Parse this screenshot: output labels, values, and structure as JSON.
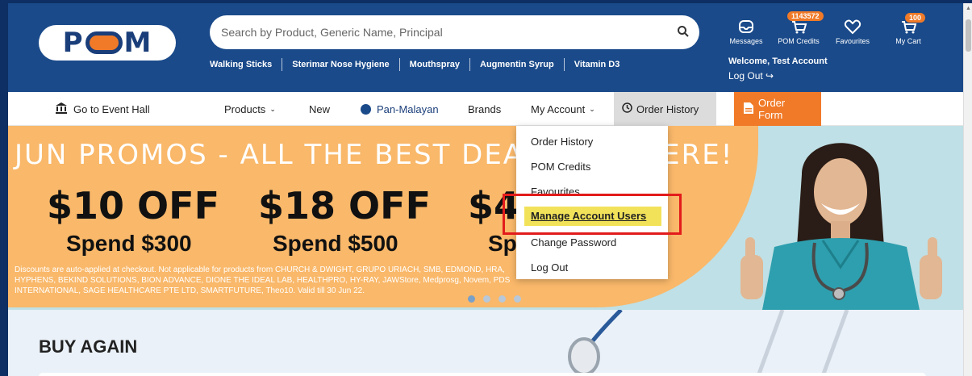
{
  "header": {
    "logo_text": "POM",
    "search_placeholder": "Search by Product, Generic Name, Principal",
    "quick_links": [
      "Walking Sticks",
      "Sterimar Nose Hygiene",
      "Mouthspray",
      "Augmentin Syrup",
      "Vitamin D3"
    ],
    "icons": [
      {
        "label": "Messages",
        "icon": "inbox-icon"
      },
      {
        "label": "POM Credits",
        "icon": "cart-icon",
        "badge": "1143572"
      },
      {
        "label": "Favourites",
        "icon": "heart-icon"
      },
      {
        "label": "My Cart",
        "icon": "cart-icon",
        "badge": "100"
      }
    ],
    "welcome": "Welcome, Test Account",
    "logout": "Log Out"
  },
  "nav": {
    "event_hall": "Go to Event Hall",
    "products": "Products",
    "new": "New",
    "pan_malayan": "Pan-Malayan",
    "brands": "Brands",
    "my_account": "My Account",
    "order_history": "Order History",
    "order_form": "Order Form"
  },
  "dropdown": {
    "items": [
      "Order History",
      "POM Credits",
      "Favourites",
      "Manage Account Users",
      "Change Password",
      "Log Out"
    ],
    "highlighted": "Manage Account Users"
  },
  "banner": {
    "headline": "JUN PROMOS - ALL THE BEST DEALS ARE HERE!",
    "offers": [
      {
        "off": "$10 OFF",
        "spend": "Spend $300"
      },
      {
        "off": "$18 OFF",
        "spend": "Spend $500"
      },
      {
        "off": "$4",
        "spend": "Sp"
      }
    ],
    "fine_print": "Discounts are auto-applied at checkout. Not applicable for products from CHURCH & DWIGHT, GRUPO URIACH, SMB, EDMOND, HRA, HYPHENS, BEKIND SOLUTIONS, BION ADVANCE, DIONE THE IDEAL LAB, HEALTHPRO, HY-RAY, JAWStore, Medprosg, Novem, PDS INTERNATIONAL, SAGE HEALTHCARE PTE LTD, SMARTFUTURE, Theo10. Valid till 30 Jun 22.",
    "carousel_dots": 4
  },
  "section": {
    "title": "BUY AGAIN"
  },
  "colors": {
    "header": "#1a4a8a",
    "accent": "#f07a28",
    "banner": "#f9b86a",
    "highlight": "#f2e25a"
  }
}
